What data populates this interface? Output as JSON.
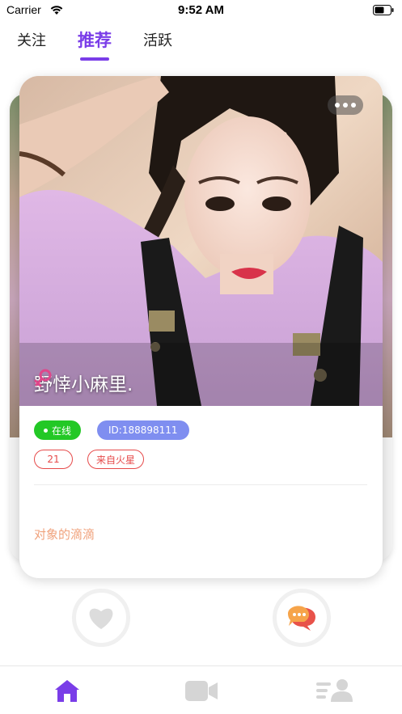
{
  "status_bar": {
    "carrier": "Carrier",
    "time": "9:52 AM",
    "wifi_icon": "wifi-icon",
    "battery_icon": "battery-icon"
  },
  "tabs": [
    {
      "label": "关注",
      "active": false
    },
    {
      "label": "推荐",
      "active": true
    },
    {
      "label": "活跃",
      "active": false
    }
  ],
  "card": {
    "nickname": "野悻小麻里.",
    "gender_icon": "female-icon",
    "online_label": "在线",
    "user_id": "ID:188898111",
    "tags": [
      "21",
      "来自火星"
    ],
    "signature": "对象的滴滴",
    "more_icon": "more-dots-icon"
  },
  "actions": {
    "like_icon": "heart-icon",
    "chat_icon": "chat-bubble-icon"
  },
  "bottom_nav": [
    {
      "icon": "home-icon",
      "active": true
    },
    {
      "icon": "video-camera-icon",
      "active": false
    },
    {
      "icon": "user-list-icon",
      "active": false
    }
  ],
  "colors": {
    "accent": "#7a3de8",
    "online": "#23c826",
    "id_badge": "#7f8ef0",
    "tag_border": "#e64a4a",
    "signature": "#f0a27c",
    "female_icon": "#e0468a"
  }
}
